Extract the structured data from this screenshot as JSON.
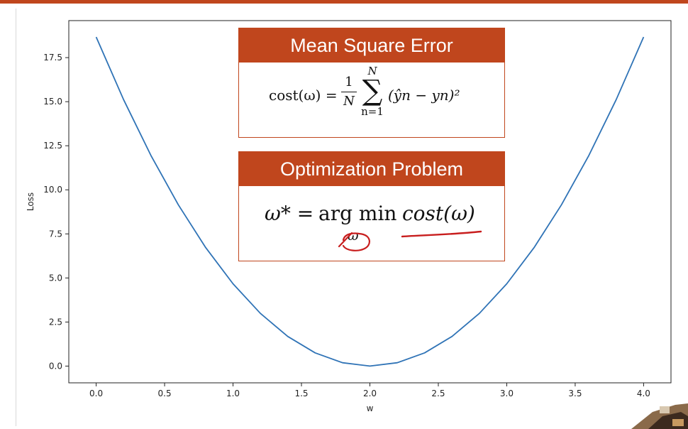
{
  "colors": {
    "accent": "#c0461d",
    "line": "#2f73b6",
    "ink": "#c81e1e"
  },
  "chart_data": {
    "type": "line",
    "title": "",
    "xlabel": "w",
    "ylabel": "Loss",
    "xlim": [
      -0.2,
      4.2
    ],
    "ylim": [
      -0.95,
      19.6
    ],
    "xticks": [
      "0.0",
      "0.5",
      "1.0",
      "1.5",
      "2.0",
      "2.5",
      "3.0",
      "3.5",
      "4.0"
    ],
    "yticks": [
      "0.0",
      "2.5",
      "5.0",
      "7.5",
      "10.0",
      "12.5",
      "15.0",
      "17.5"
    ],
    "grid": false,
    "series": [
      {
        "x": [
          0.0,
          0.2,
          0.4,
          0.6,
          0.8,
          1.0,
          1.2,
          1.4,
          1.6,
          1.8,
          2.0,
          2.2,
          2.4,
          2.6,
          2.8,
          3.0,
          3.2,
          3.4,
          3.6,
          3.8,
          4.0
        ],
        "y": [
          18.67,
          15.12,
          11.95,
          9.15,
          6.72,
          4.67,
          2.99,
          1.68,
          0.75,
          0.19,
          0.0,
          0.19,
          0.75,
          1.68,
          2.99,
          4.67,
          6.72,
          9.15,
          11.95,
          15.12,
          18.67
        ]
      }
    ]
  },
  "overlay": {
    "mse_title": "Mean Square Error",
    "mse_formula": {
      "lhs": "cost(ω) =",
      "frac_num": "1",
      "frac_den": "N",
      "sum_upper": "N",
      "sum_symbol": "∑",
      "sum_lower": "n=1",
      "term": "(ŷn − yn)²"
    },
    "opt_title": "Optimization Problem",
    "opt_formula": {
      "lhs": "ω* =",
      "op": "arg min",
      "arg": "cost(ω)",
      "sub": "ω"
    }
  }
}
